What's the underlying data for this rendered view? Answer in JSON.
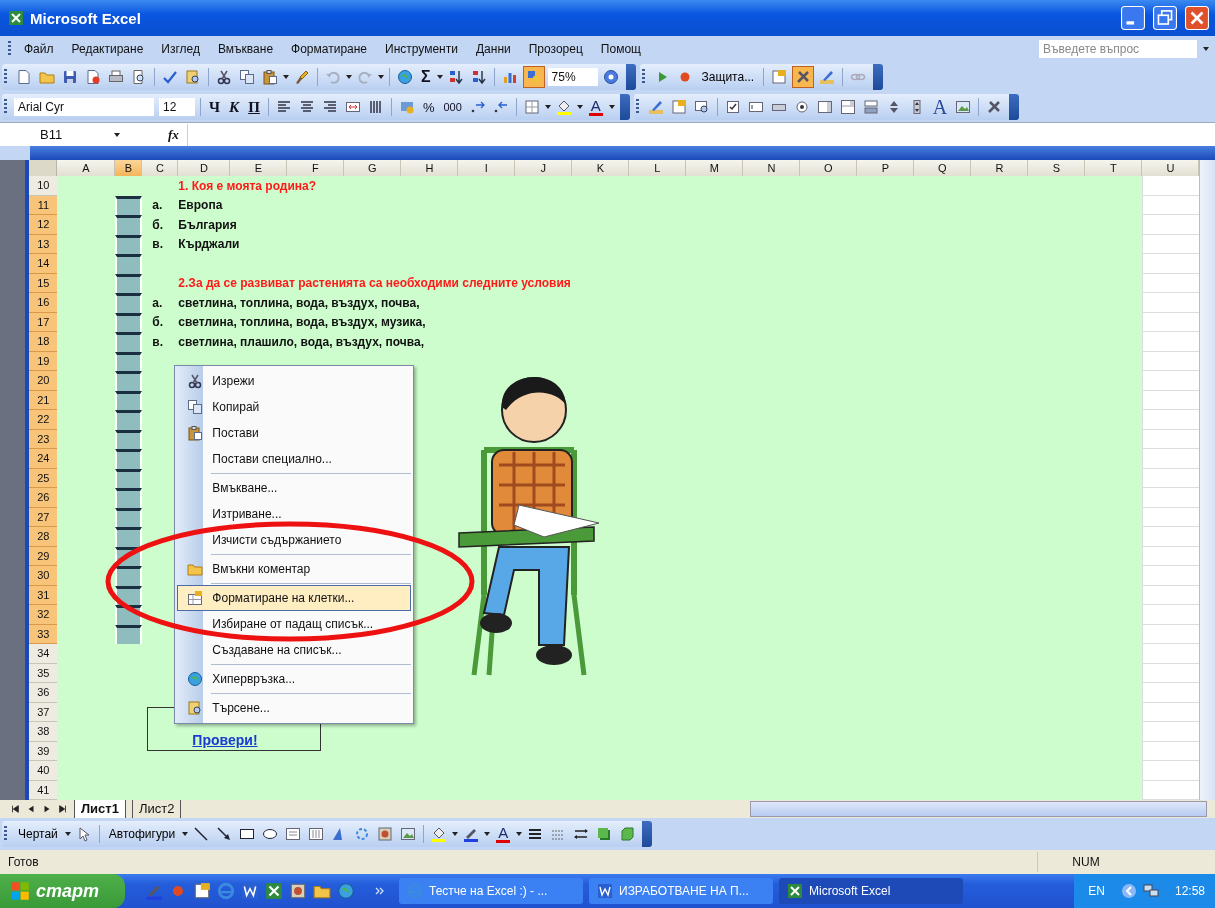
{
  "window": {
    "title": "Microsoft Excel"
  },
  "menu": [
    "Файл",
    "Редактиране",
    "Изглед",
    "Вмъкване",
    "Форматиране",
    "Инструменти",
    "Данни",
    "Прозорец",
    "Помощ"
  ],
  "help_box": {
    "placeholder": "Въведете въпрос"
  },
  "standard_toolbar": {
    "sum": "Σ",
    "zoom": "75%",
    "drawing_button": {
      "pressed": true
    }
  },
  "control_toolbar": {
    "protection": "Защита...",
    "design_mode": {
      "pressed": true
    }
  },
  "formatting_toolbar": {
    "font": "Arial Cyr",
    "size": "12",
    "bold": "Ч",
    "italic": "К",
    "underline": "П",
    "percent": "%",
    "thousands": "000",
    "font_color": "A"
  },
  "control_toolbox": {
    "label_control": "A"
  },
  "formula_bar": {
    "name_box": "B11",
    "function_label": "fx"
  },
  "columns": [
    {
      "label": "A",
      "selected": false
    },
    {
      "label": "B",
      "selected": true
    },
    {
      "label": "C",
      "selected": false
    },
    {
      "label": "D",
      "selected": false
    },
    {
      "label": "E",
      "selected": false
    },
    {
      "label": "F",
      "selected": false
    },
    {
      "label": "G",
      "selected": false
    },
    {
      "label": "H",
      "selected": false
    },
    {
      "label": "I",
      "selected": false
    },
    {
      "label": "J",
      "selected": false
    },
    {
      "label": "K",
      "selected": false
    },
    {
      "label": "L",
      "selected": false
    },
    {
      "label": "M",
      "selected": false
    },
    {
      "label": "N",
      "selected": false
    },
    {
      "label": "O",
      "selected": false
    },
    {
      "label": "P",
      "selected": false
    },
    {
      "label": "Q",
      "selected": false
    },
    {
      "label": "R",
      "selected": false
    },
    {
      "label": "S",
      "selected": false
    },
    {
      "label": "T",
      "selected": false
    },
    {
      "label": "U",
      "selected": false
    }
  ],
  "rows": [
    {
      "number": "10",
      "selected": false,
      "question": "1. Коя е моята родина?"
    },
    {
      "number": "11",
      "selected": true,
      "letter": "а.",
      "answer": "Европа"
    },
    {
      "number": "12",
      "selected": true,
      "letter": "б.",
      "answer": "България"
    },
    {
      "number": "13",
      "selected": true,
      "letter": "в.",
      "answer": "Кърджали"
    },
    {
      "number": "14",
      "selected": true
    },
    {
      "number": "15",
      "selected": true,
      "question": "2.За да се развиват растенията са необходими следните условия"
    },
    {
      "number": "16",
      "selected": true,
      "letter": "а.",
      "answer": "светлина, топлина, вода, въздух, почва,"
    },
    {
      "number": "17",
      "selected": true,
      "letter": "б.",
      "answer": "светлина, топлина, вода, въздух, музика,"
    },
    {
      "number": "18",
      "selected": true,
      "letter": "в.",
      "answer": "светлина, плашило, вода, въздух, почва,"
    },
    {
      "number": "19",
      "selected": true
    },
    {
      "number": "20",
      "selected": true
    },
    {
      "number": "21",
      "selected": true
    },
    {
      "number": "22",
      "selected": true
    },
    {
      "number": "23",
      "selected": true
    },
    {
      "number": "24",
      "selected": true
    },
    {
      "number": "25",
      "selected": true
    },
    {
      "number": "26",
      "selected": true
    },
    {
      "number": "27",
      "selected": true
    },
    {
      "number": "28",
      "selected": true
    },
    {
      "number": "29",
      "selected": true
    },
    {
      "number": "30",
      "selected": true
    },
    {
      "number": "31",
      "selected": true
    },
    {
      "number": "32",
      "selected": true
    },
    {
      "number": "33",
      "selected": true
    },
    {
      "number": "34",
      "selected": false
    },
    {
      "number": "35",
      "selected": false
    },
    {
      "number": "36",
      "selected": false
    },
    {
      "number": "37",
      "selected": false
    },
    {
      "number": "38",
      "selected": false
    },
    {
      "number": "39",
      "selected": false
    },
    {
      "number": "40",
      "selected": false
    },
    {
      "number": "41",
      "selected": false
    }
  ],
  "context_menu": {
    "items": [
      {
        "label": "Изрежи",
        "selected": false,
        "separator_after": false
      },
      {
        "label": "Копирай",
        "selected": false,
        "separator_after": false
      },
      {
        "label": "Постави",
        "selected": false,
        "separator_after": false
      },
      {
        "label": "Постави специално...",
        "selected": false,
        "separator_after": true
      },
      {
        "label": "Вмъкване...",
        "selected": false,
        "separator_after": false
      },
      {
        "label": "Изтриване...",
        "selected": false,
        "separator_after": false
      },
      {
        "label": "Изчисти съдържанието",
        "selected": false,
        "separator_after": true
      },
      {
        "label": "Вмъкни коментар",
        "selected": false,
        "separator_after": true
      },
      {
        "label": "Форматиране на клетки...",
        "selected": true,
        "separator_after": false
      },
      {
        "label": "Избиране от падащ списък...",
        "selected": false,
        "separator_after": false
      },
      {
        "label": "Създаване на списък...",
        "selected": false,
        "separator_after": true
      },
      {
        "label": "Хипервръзка...",
        "selected": false,
        "separator_after": true
      },
      {
        "label": "Търсене...",
        "selected": false,
        "separator_after": false
      }
    ]
  },
  "check_button": {
    "label": "Провери!"
  },
  "sheet_tabs": [
    {
      "label": "Лист1",
      "selected": true
    },
    {
      "label": "Лист2",
      "selected": false
    }
  ],
  "drawing_toolbar": {
    "draw_menu": "Чертай",
    "autoshapes": "Автофигури",
    "font_color": "A"
  },
  "status_bar": {
    "status": "Готов",
    "num_lock": "NUM"
  },
  "taskbar": {
    "start": "старт",
    "tasks": [
      {
        "label": "Тестче на Excel :) - ...",
        "selected": false
      },
      {
        "label": "ИЗРАБОТВАНЕ НА П...",
        "selected": false
      },
      {
        "label": "Microsoft Excel",
        "selected": true
      }
    ],
    "language": "EN",
    "clock": "12:58"
  }
}
